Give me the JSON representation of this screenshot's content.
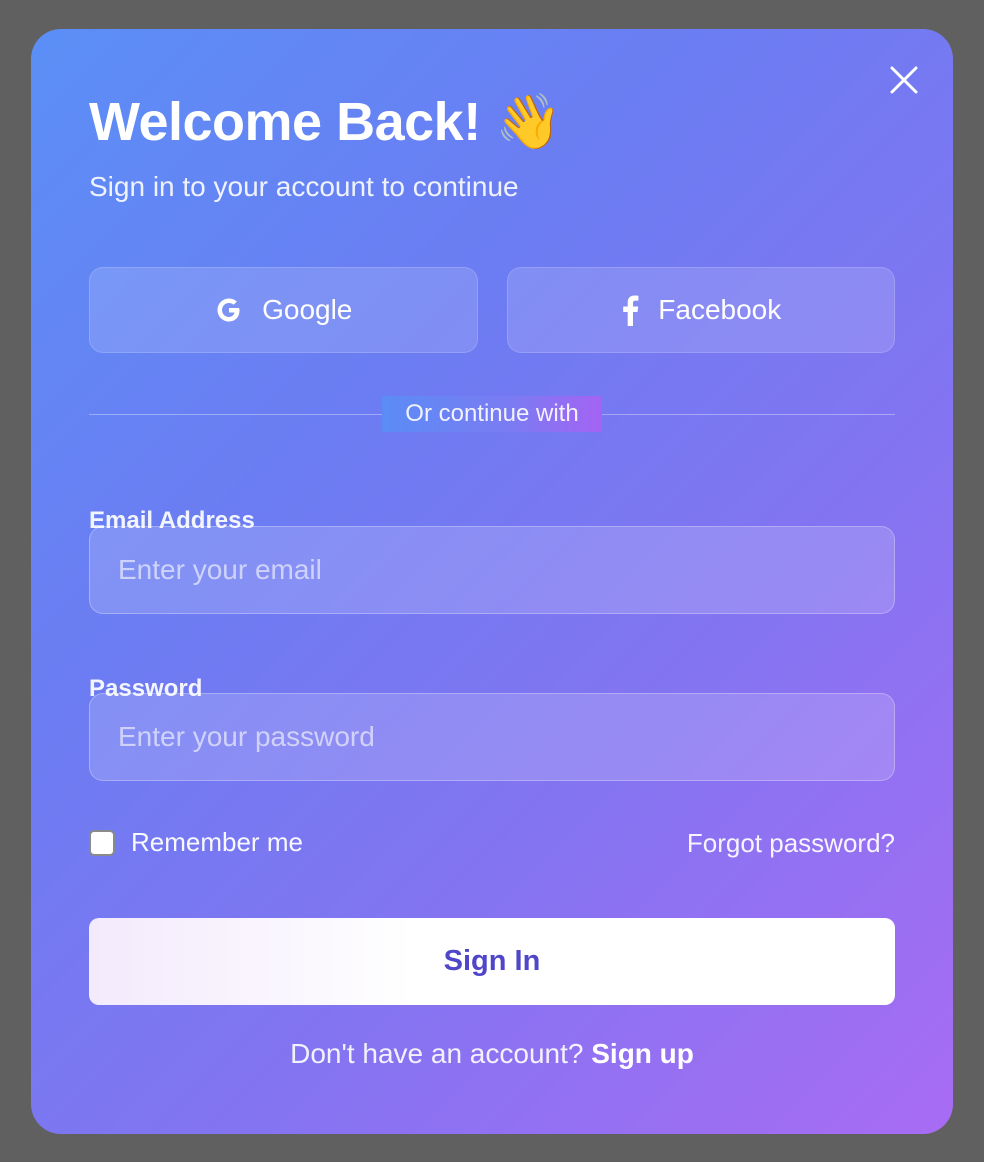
{
  "modal": {
    "title": "Welcome Back! 👋",
    "subtitle": "Sign in to your account to continue"
  },
  "social": {
    "google_label": "Google",
    "facebook_label": "Facebook"
  },
  "divider": {
    "label": "Or continue with"
  },
  "email": {
    "label": "Email Address",
    "placeholder": "Enter your email",
    "value": ""
  },
  "password": {
    "label": "Password",
    "placeholder": "Enter your password",
    "value": ""
  },
  "options": {
    "remember_label": "Remember me",
    "remember_checked": false,
    "forgot_label": "Forgot password?"
  },
  "actions": {
    "signin_label": "Sign In"
  },
  "footer": {
    "prompt": "Don't have an account?",
    "signup_label": "Sign up"
  },
  "icons": {
    "close": "close-icon",
    "google": "google-icon",
    "facebook": "facebook-icon"
  },
  "colors": {
    "gradient_start": "#5b8ff7",
    "gradient_end": "#a86cf3",
    "signin_text": "#4f46c9"
  }
}
